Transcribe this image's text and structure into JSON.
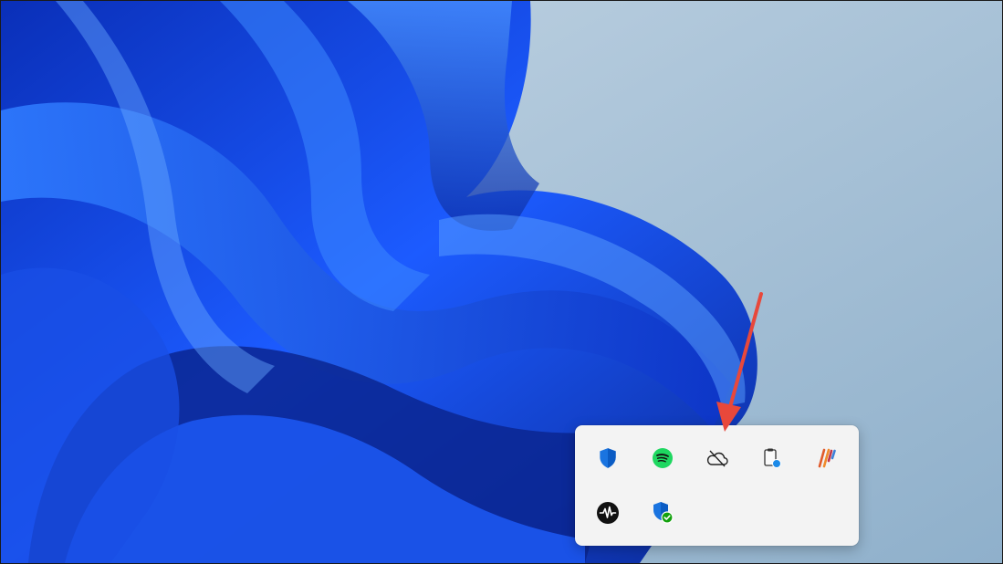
{
  "desktop": {
    "wallpaper_name": "windows-11-bloom-wallpaper",
    "accent_color": "#1a5cf0",
    "background_color": "#9db8cf"
  },
  "tray_overflow": {
    "icons": [
      {
        "name": "windows-security-shield-icon",
        "tooltip": ""
      },
      {
        "name": "spotify-icon",
        "tooltip": ""
      },
      {
        "name": "onedrive-sync-paused-icon",
        "tooltip": ""
      },
      {
        "name": "clipboard-status-icon",
        "tooltip": ""
      },
      {
        "name": "colorful-stripes-app-icon",
        "tooltip": ""
      },
      {
        "name": "audio-waveform-app-icon",
        "tooltip": ""
      },
      {
        "name": "defender-check-shield-icon",
        "tooltip": ""
      }
    ]
  },
  "annotation": {
    "arrow_color": "#e8483b",
    "points_to": "onedrive-sync-paused-icon"
  }
}
